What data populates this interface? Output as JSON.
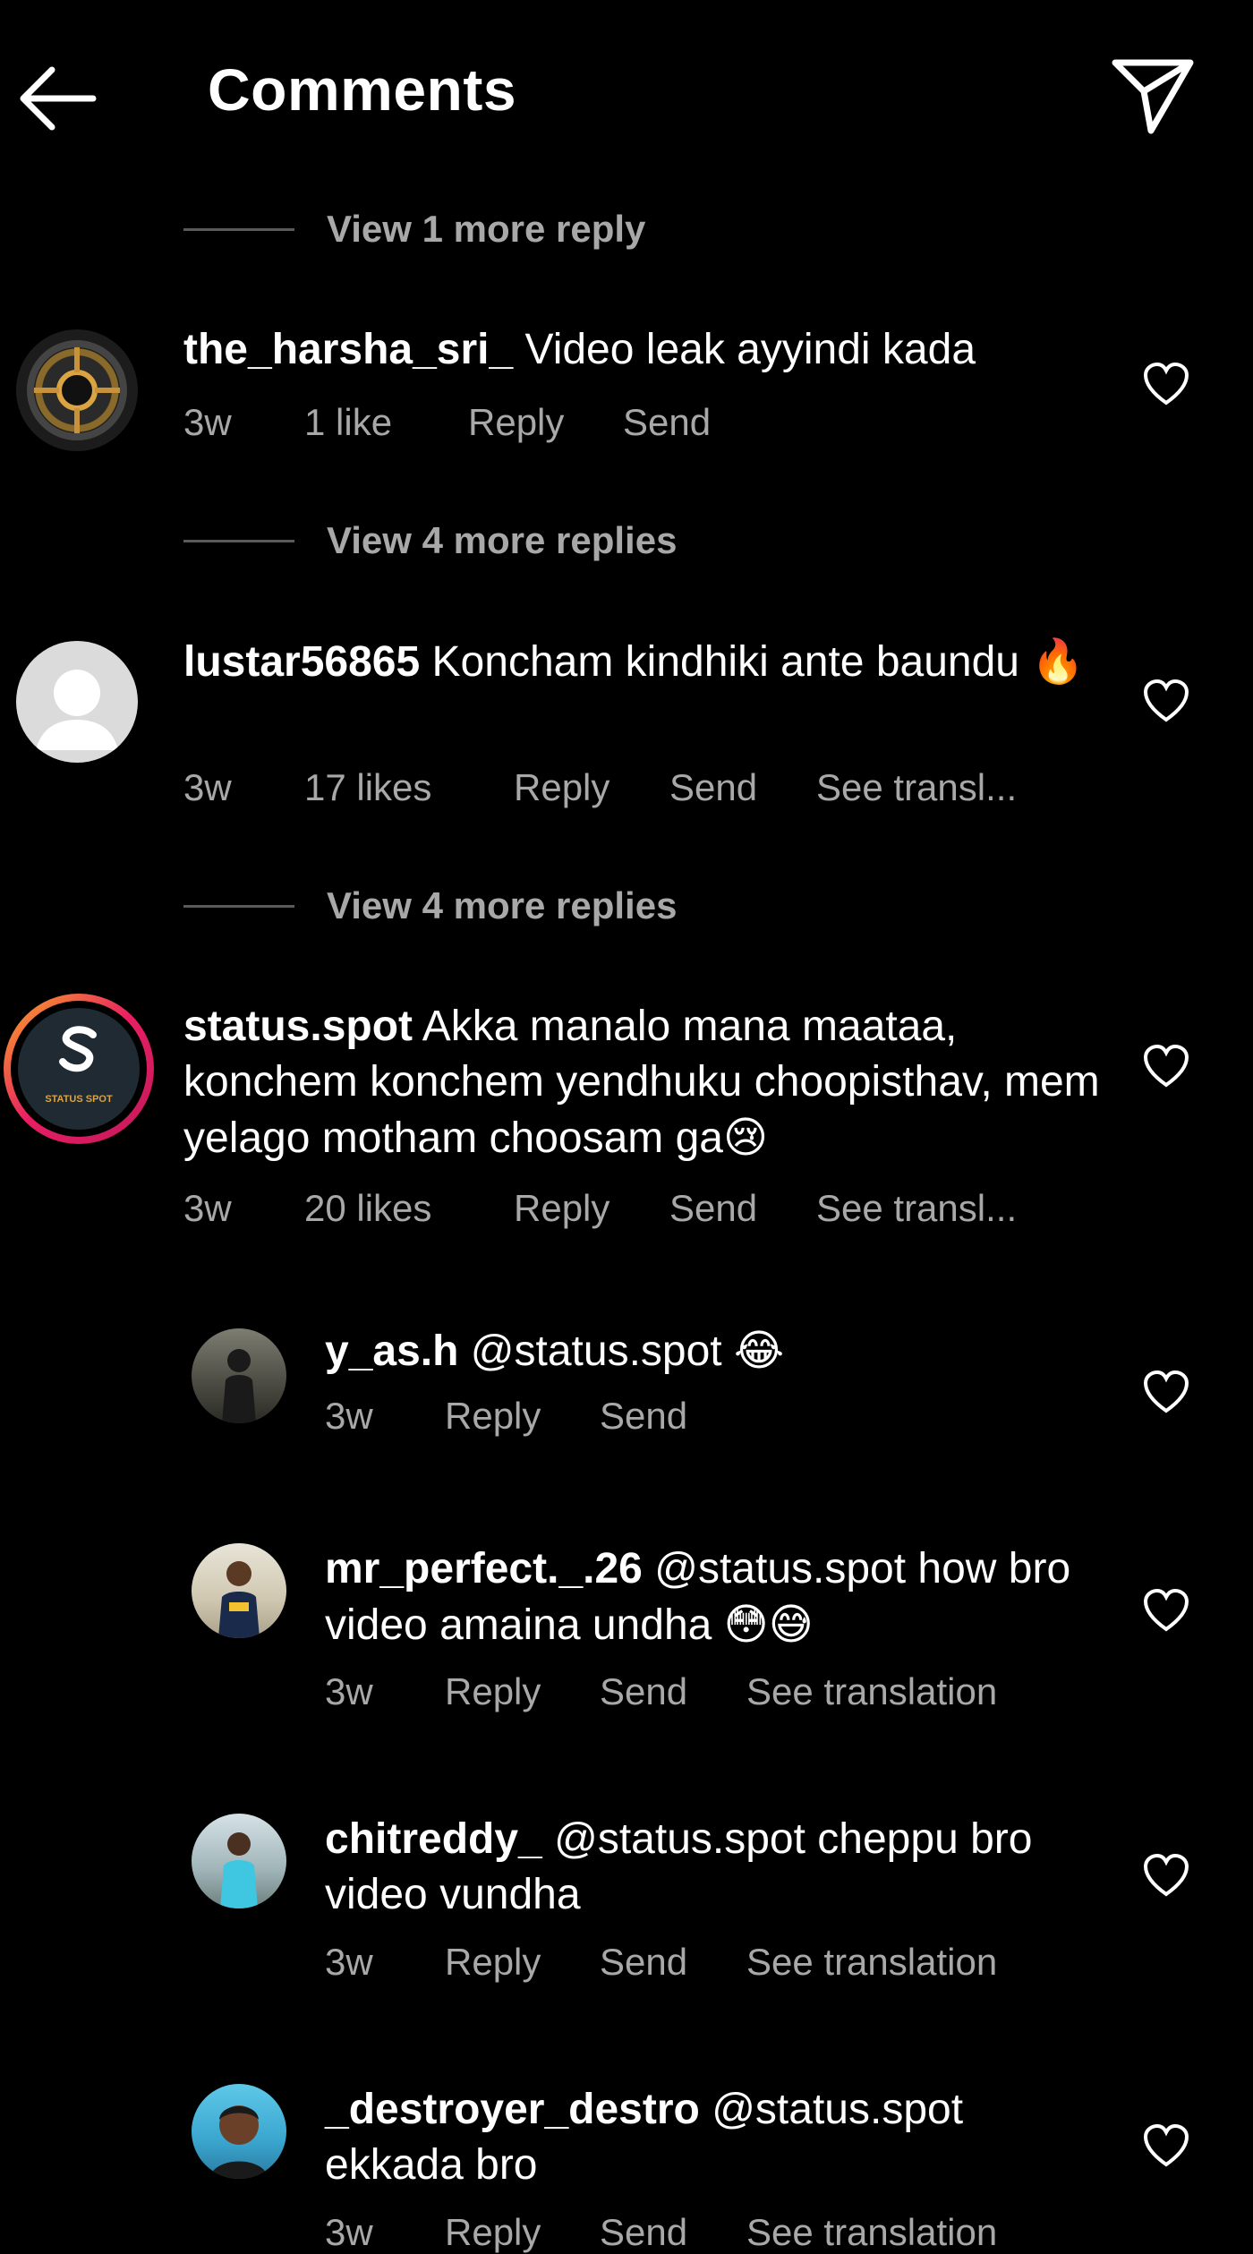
{
  "header": {
    "title": "Comments",
    "back_icon": "arrow-left-icon",
    "share_icon": "paper-plane-icon"
  },
  "view_more": [
    "View 1 more reply",
    "View 4 more replies",
    "View 4 more replies"
  ],
  "comments": [
    {
      "username": "the_harsha_sri_",
      "text": "Video leak ayyindi kada",
      "emoji": "",
      "time": "3w",
      "likes": "1 like",
      "reply": "Reply",
      "send": "Send",
      "translate": ""
    },
    {
      "username": "lustar56865",
      "text": "Koncham kindhiki ante baundu",
      "emoji": "🔥",
      "time": "3w",
      "likes": "17 likes",
      "reply": "Reply",
      "send": "Send",
      "translate": "See transl..."
    },
    {
      "username": "status.spot",
      "avatar_text": "STATUS SPOT",
      "text": "Akka manalo mana maataa, konchem konchem yendhuku choopisthav, mem yelago motham choosam ga",
      "emoji": "😢",
      "time": "3w",
      "likes": "20 likes",
      "reply": "Reply",
      "send": "Send",
      "translate": "See transl..."
    }
  ],
  "replies": [
    {
      "username": "y_as.h",
      "text": "@status.spot",
      "emoji": "😂",
      "time": "3w",
      "reply": "Reply",
      "send": "Send",
      "translate": ""
    },
    {
      "username": "mr_perfect._.26",
      "text": "@status.spot how bro video amaina undha",
      "emoji": "😳😅",
      "time": "3w",
      "reply": "Reply",
      "send": "Send",
      "translate": "See translation"
    },
    {
      "username": "chitreddy_",
      "text": "@status.spot cheppu bro video vundha",
      "emoji": "",
      "time": "3w",
      "reply": "Reply",
      "send": "Send",
      "translate": "See translation"
    },
    {
      "username": "_destroyer_destro",
      "text": "@status.spot ekkada bro",
      "emoji": "",
      "time": "3w",
      "reply": "Reply",
      "send": "Send",
      "translate": "See translation"
    }
  ]
}
